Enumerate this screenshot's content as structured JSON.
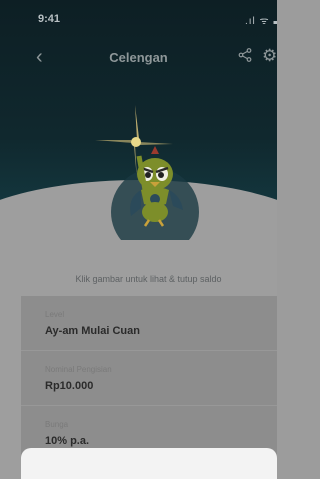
{
  "status_bar": {
    "time": "9:41",
    "icons": ".ıl ᯤ ▬"
  },
  "nav": {
    "back_icon": "‹",
    "title": "Celengan",
    "share_icon": "share-icon",
    "settings_icon": "gear-icon"
  },
  "hint": "Klik gambar untuk lihat & tutup saldo",
  "rows": [
    {
      "label": "Level",
      "value": "Ay-am Mulai Cuan",
      "chevron": true
    },
    {
      "label": "Nominal Pengisian",
      "value": "Rp10.000",
      "chevron": true
    },
    {
      "label": "Bunga",
      "value": "10% p.a.",
      "chevron": false
    }
  ],
  "colors": {
    "header_dark": "#0d1f24",
    "overlay_gray": "#9e9e9e",
    "mascot_green": "#7d8e2a",
    "sparkle": "#d9c37a"
  }
}
